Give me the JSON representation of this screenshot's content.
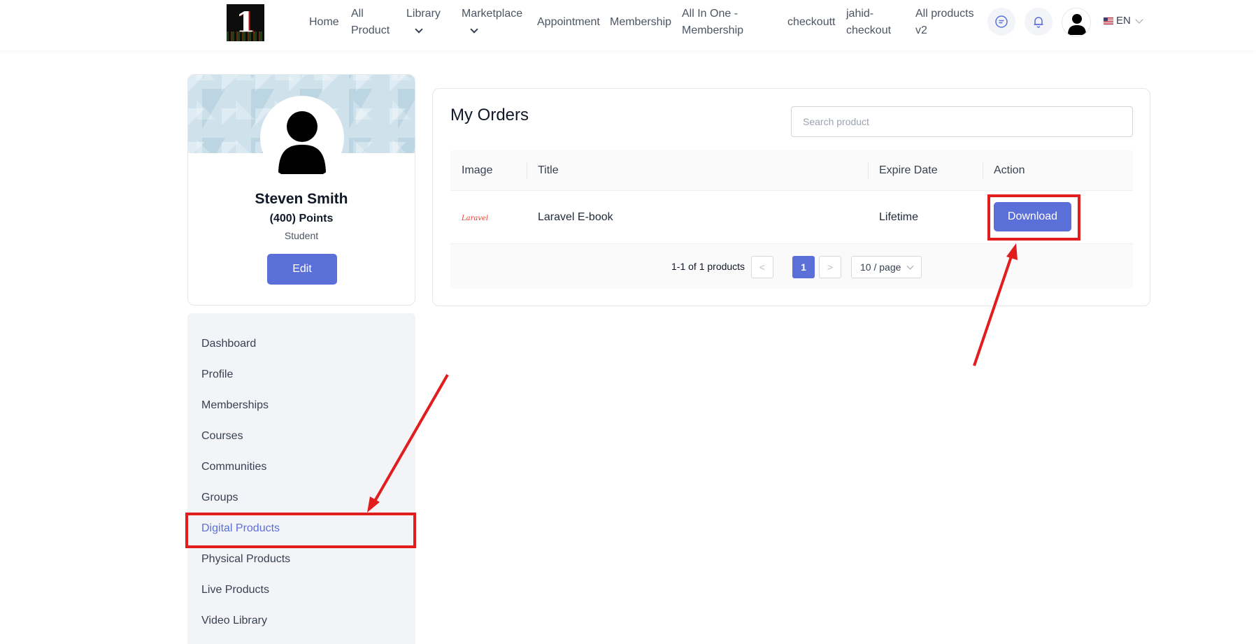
{
  "nav": {
    "logo_glyph": "1",
    "items": [
      {
        "label": "Home",
        "dropdown": false
      },
      {
        "label": "All Product",
        "dropdown": false
      },
      {
        "label": "Library",
        "dropdown": true
      },
      {
        "label": "Marketplace",
        "dropdown": true
      },
      {
        "label": "Appointment",
        "dropdown": false
      },
      {
        "label": "Membership",
        "dropdown": false
      },
      {
        "label": "All In One - Membership",
        "dropdown": false
      },
      {
        "label": "checkoutt",
        "dropdown": false
      },
      {
        "label": "jahid-checkout",
        "dropdown": false
      },
      {
        "label": "All products v2",
        "dropdown": false
      }
    ],
    "lang": "EN",
    "icons": [
      "chat-icon",
      "bell-icon",
      "user-avatar"
    ]
  },
  "profile": {
    "name": "Steven Smith",
    "points": "(400) Points",
    "role": "Student",
    "edit_label": "Edit"
  },
  "sidebar": {
    "items": [
      {
        "label": "Dashboard",
        "active": false
      },
      {
        "label": "Profile",
        "active": false
      },
      {
        "label": "Memberships",
        "active": false
      },
      {
        "label": "Courses",
        "active": false
      },
      {
        "label": "Communities",
        "active": false
      },
      {
        "label": "Groups",
        "active": false
      },
      {
        "label": "Digital Products",
        "active": true
      },
      {
        "label": "Physical Products",
        "active": false
      },
      {
        "label": "Live Products",
        "active": false
      },
      {
        "label": "Video Library",
        "active": false
      }
    ]
  },
  "orders": {
    "title": "My Orders",
    "search_placeholder": "Search product",
    "columns": [
      "Image",
      "Title",
      "Expire Date",
      "Action"
    ],
    "rows": [
      {
        "image_text": "Laravel",
        "title": "Laravel E-book",
        "expire": "Lifetime",
        "action": "Download"
      }
    ],
    "pagination": {
      "total": "1-1 of 1 products",
      "prev": "<",
      "current": "1",
      "next": ">",
      "page_size": "10 / page"
    }
  },
  "colors": {
    "accent": "#5b6fd8",
    "annotation": "#e11d1d"
  }
}
